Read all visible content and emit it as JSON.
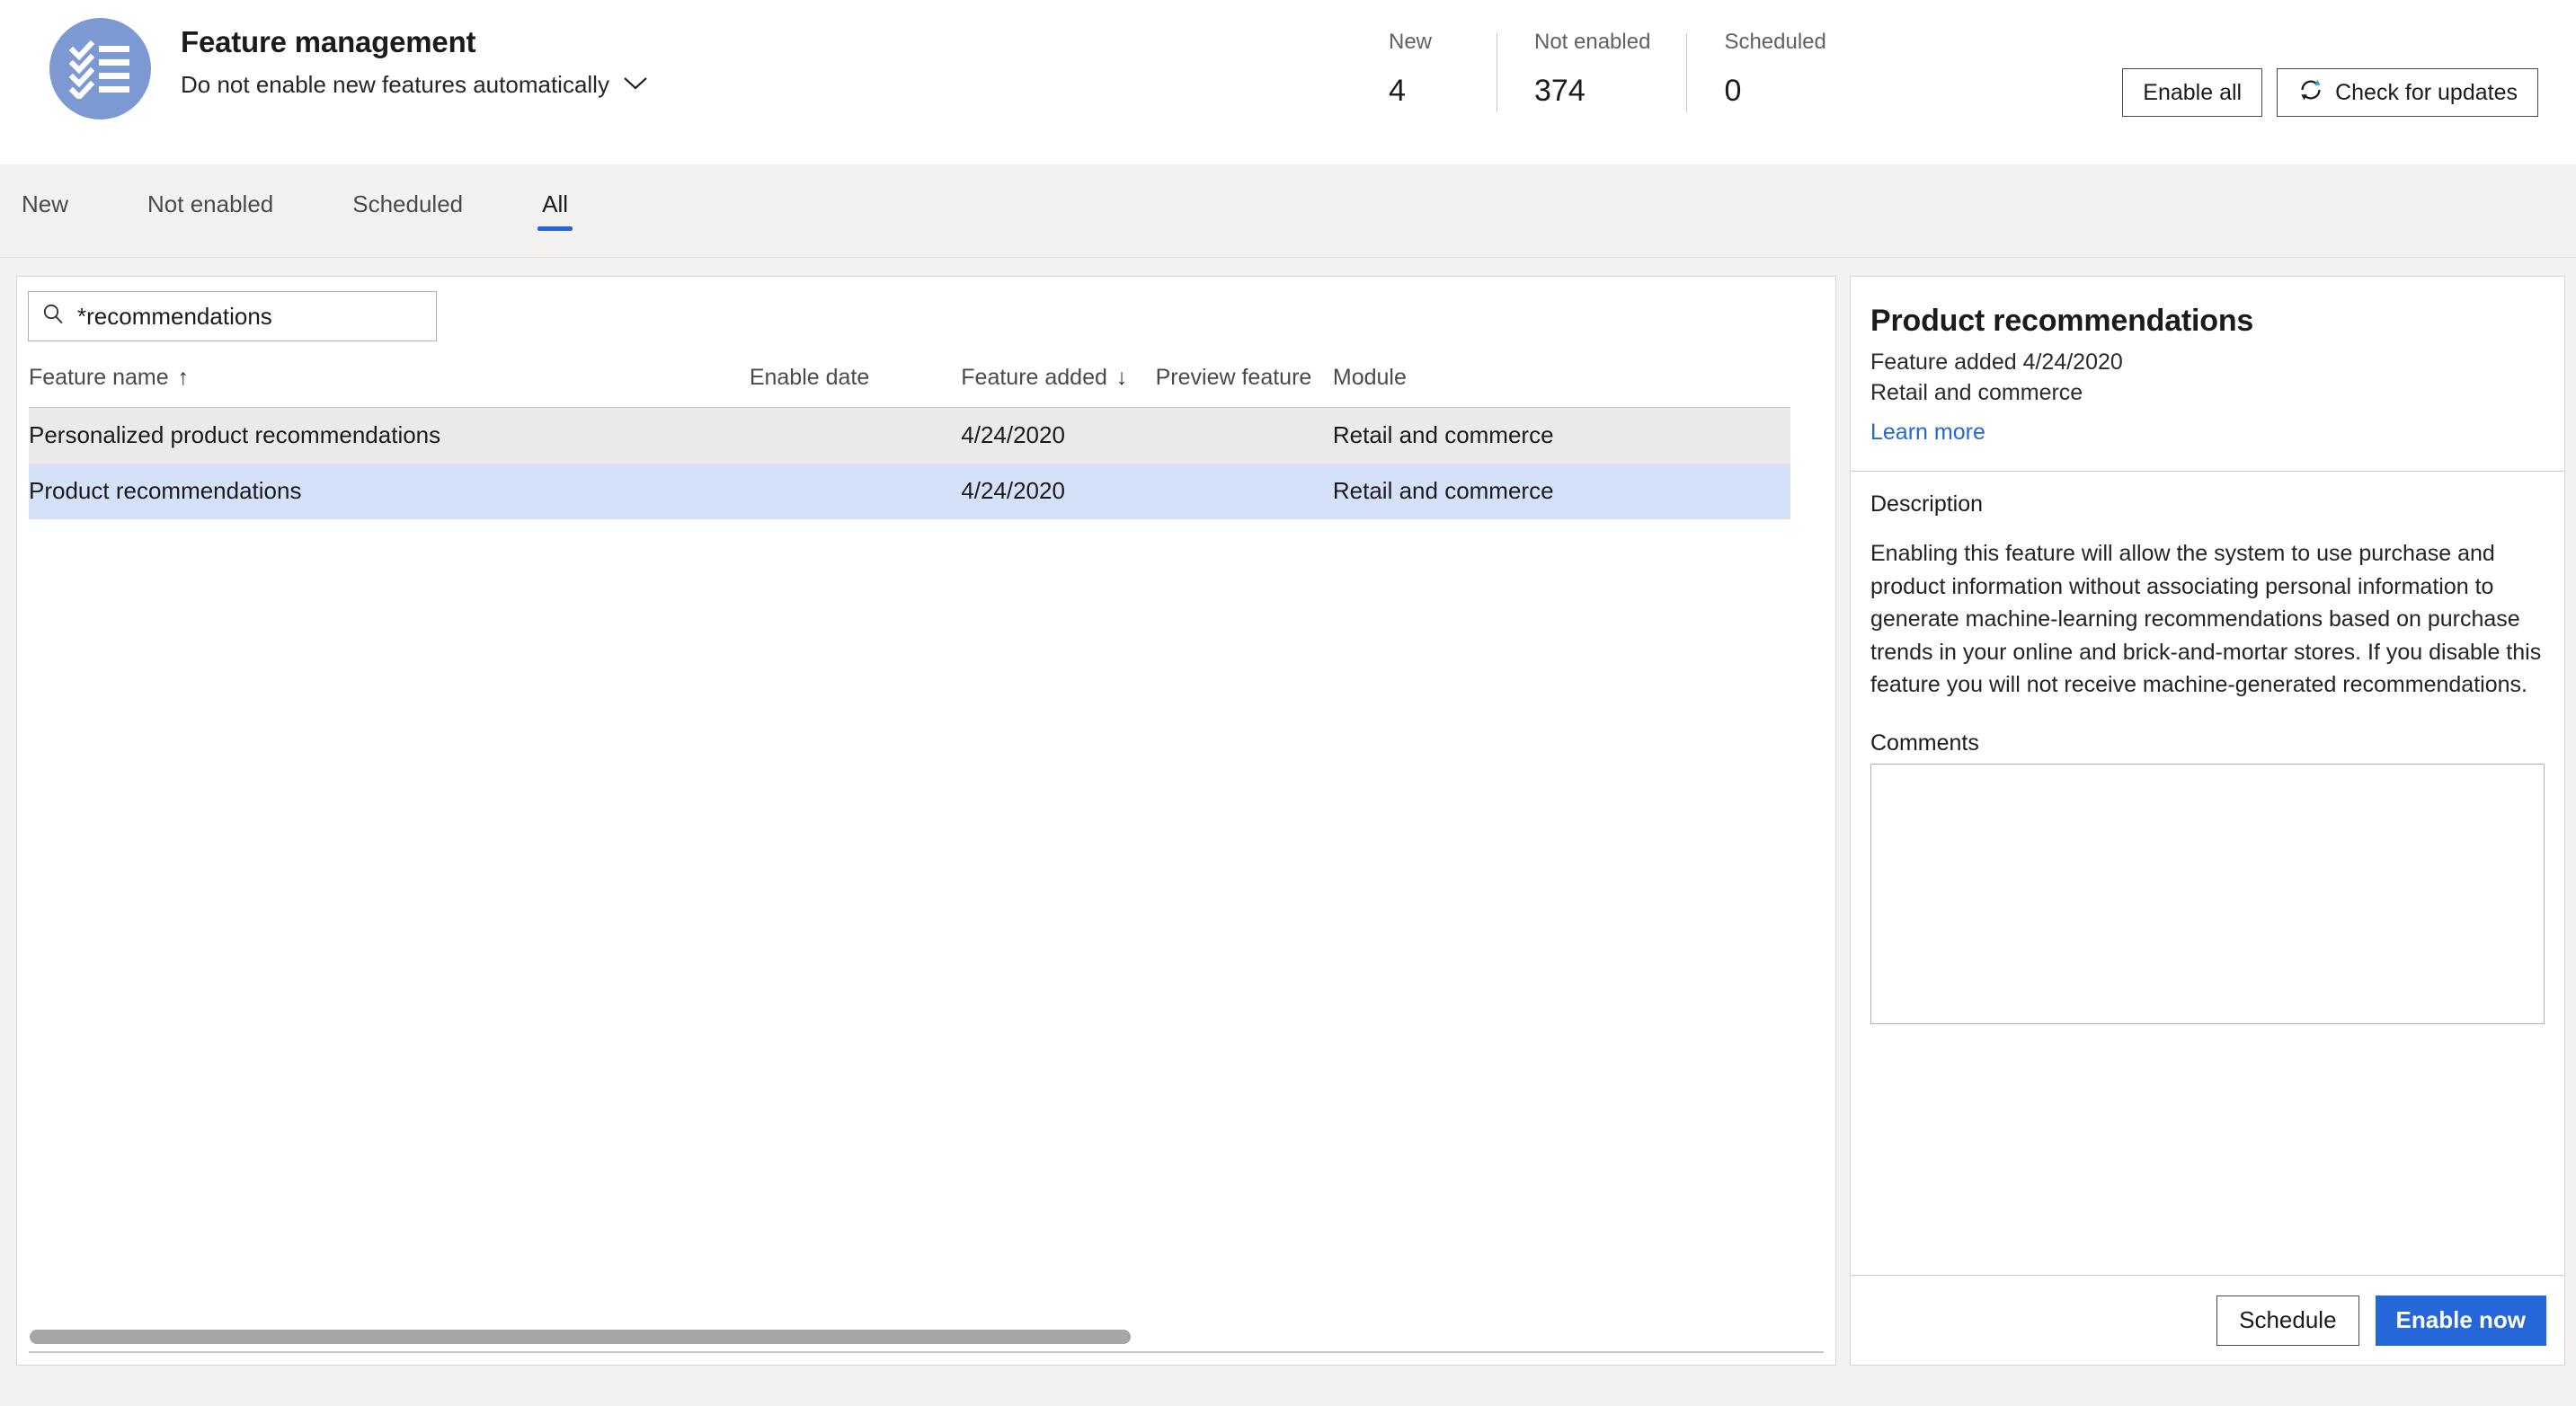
{
  "header": {
    "app_icon": "checklist-icon",
    "title": "Feature management",
    "subtitle": "Do not enable new features automatically",
    "subtitle_chevron": "chevron-down-icon",
    "stats": [
      {
        "label": "New",
        "value": "4"
      },
      {
        "label": "Not enabled",
        "value": "374"
      },
      {
        "label": "Scheduled",
        "value": "0"
      }
    ],
    "buttons": {
      "enable_all": "Enable all",
      "check_updates": "Check for updates",
      "check_updates_icon": "refresh-icon"
    }
  },
  "tabs": [
    {
      "label": "New",
      "active": false
    },
    {
      "label": "Not enabled",
      "active": false
    },
    {
      "label": "Scheduled",
      "active": false
    },
    {
      "label": "All",
      "active": true
    }
  ],
  "search": {
    "icon": "search-icon",
    "value": "*recommendations",
    "placeholder": "Filter"
  },
  "table": {
    "columns": [
      {
        "label": "Feature name",
        "sort": "ascending",
        "sort_glyph": "↑"
      },
      {
        "label": "Enable date",
        "sort": "none",
        "sort_glyph": ""
      },
      {
        "label": "Feature added",
        "sort": "descending",
        "sort_glyph": "↓"
      },
      {
        "label": "Preview feature",
        "sort": "none",
        "sort_glyph": ""
      },
      {
        "label": "Module",
        "sort": "none",
        "sort_glyph": ""
      }
    ],
    "rows": [
      {
        "feature_name": "Personalized product recommendations",
        "enable_date": "",
        "feature_added": "4/24/2020",
        "preview_feature": "",
        "module": "Retail and commerce",
        "selected": false
      },
      {
        "feature_name": "Product recommendations",
        "enable_date": "",
        "feature_added": "4/24/2020",
        "preview_feature": "",
        "module": "Retail and commerce",
        "selected": true
      }
    ]
  },
  "detail": {
    "title": "Product recommendations",
    "added_line": "Feature added 4/24/2020",
    "module_line": "Retail and commerce",
    "learn_more": "Learn more",
    "description_label": "Description",
    "description": "Enabling this feature will allow the system to use purchase and product information without associating personal information to generate machine-learning recommendations based on purchase trends in your online and brick-and-mortar stores. If you disable this feature you will not receive machine-generated recommendations.",
    "comments_label": "Comments",
    "comments_value": "",
    "schedule_button": "Schedule",
    "enable_now_button": "Enable now"
  },
  "colors": {
    "accent": "#2566d8",
    "icon_blue": "#7C99D4",
    "selected_row": "#d5e1f8",
    "alt_row": "#ebeae8",
    "chrome_bg": "#f3f2f1"
  }
}
